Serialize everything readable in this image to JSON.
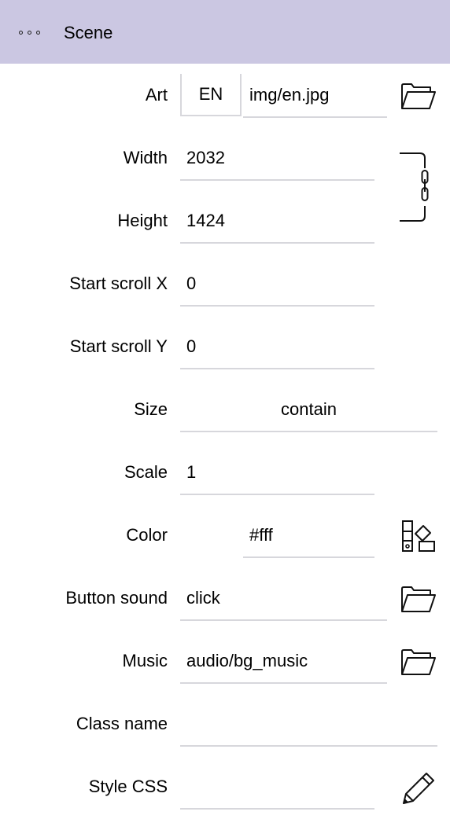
{
  "header": {
    "title": "Scene",
    "menu_icon": "more-dots-icon"
  },
  "fields": {
    "art": {
      "label": "Art",
      "lang": "EN",
      "value": "img/en.jpg",
      "icon": "folder-icon"
    },
    "width": {
      "label": "Width",
      "value": "2032"
    },
    "height": {
      "label": "Height",
      "value": "1424"
    },
    "link_icon": "chain-link-icon",
    "start_scroll_x": {
      "label": "Start scroll X",
      "value": "0"
    },
    "start_scroll_y": {
      "label": "Start scroll Y",
      "value": "0"
    },
    "size": {
      "label": "Size",
      "value": "contain"
    },
    "scale": {
      "label": "Scale",
      "value": "1"
    },
    "color": {
      "label": "Color",
      "value": "#fff",
      "icon": "palette-icon"
    },
    "button_sound": {
      "label": "Button sound",
      "value": "click",
      "icon": "folder-icon"
    },
    "music": {
      "label": "Music",
      "value": "audio/bg_music",
      "icon": "folder-icon"
    },
    "class_name": {
      "label": "Class name",
      "value": ""
    },
    "style_css": {
      "label": "Style CSS",
      "value": "",
      "icon": "pencil-icon"
    }
  },
  "colors": {
    "header_bg": "#cbc7e2",
    "underline": "#d7d7dc"
  }
}
